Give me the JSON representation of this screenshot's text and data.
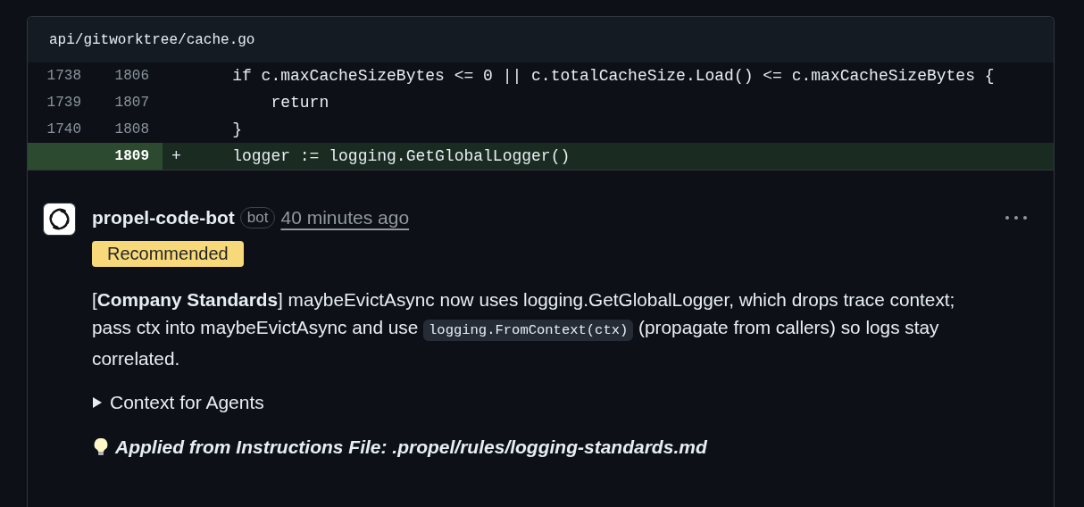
{
  "file": {
    "path": "api/gitworktree/cache.go"
  },
  "diff_lines": [
    {
      "old_number": "1738",
      "new_number": "1806",
      "code": "    if c.maxCacheSizeBytes <= 0 || c.totalCacheSize.Load() <= c.maxCacheSizeBytes {",
      "kind": "context"
    },
    {
      "old_number": "1739",
      "new_number": "1807",
      "code": "        return",
      "kind": "context"
    },
    {
      "old_number": "1740",
      "new_number": "1808",
      "code": "    }",
      "kind": "context"
    },
    {
      "new_number": "1809",
      "marker": "+",
      "code": "    logger := logging.GetGlobalLogger()",
      "kind": "added"
    }
  ],
  "comment": {
    "author": "propel-code-bot",
    "author_badge": "bot",
    "time": "40 minutes ago",
    "label": "Recommended",
    "body": [
      {
        "kind": "text",
        "text": "[**Company Standards**] maybeEvictAsync now uses logging.GetGlobalLogger, which drops trace context; pass ctx into maybeEvictAsync and use "
      },
      {
        "kind": "code",
        "text": "logging.FromContext(ctx)"
      },
      {
        "kind": "text",
        "text": " (propagate from callers) so logs stay correlated."
      }
    ],
    "details": {
      "summary": "Context for Agents",
      "expanded": false
    },
    "footer": "Applied from Instructions File: .propel/rules/logging-standards.md"
  }
}
